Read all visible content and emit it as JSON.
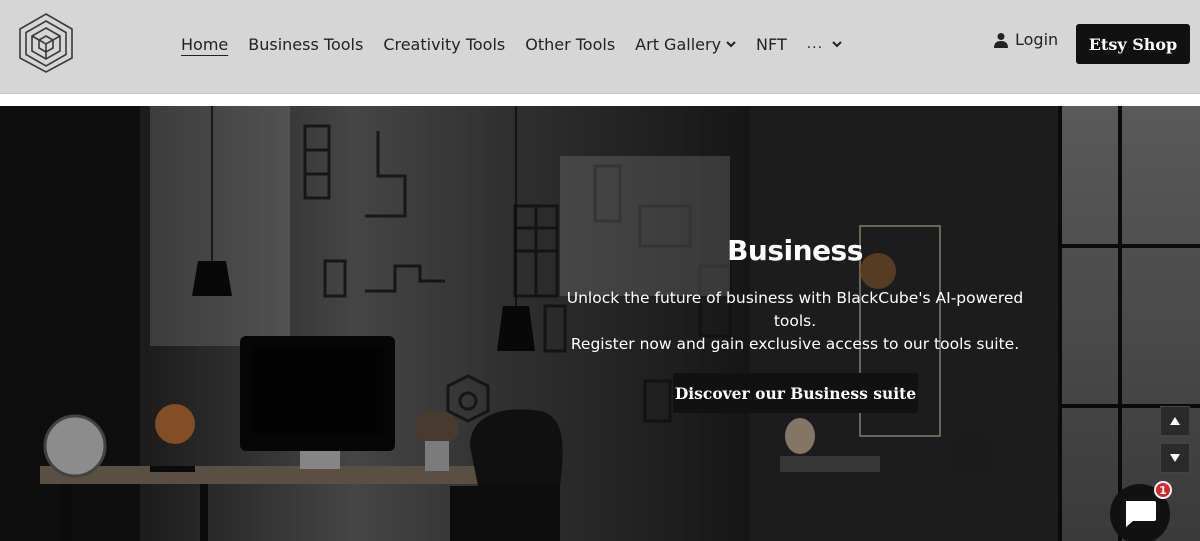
{
  "header": {
    "nav": [
      {
        "label": "Home"
      },
      {
        "label": "Business Tools"
      },
      {
        "label": "Creativity Tools"
      },
      {
        "label": "Other Tools"
      },
      {
        "label": "Art Gallery"
      },
      {
        "label": "NFT"
      },
      {
        "label": "..."
      }
    ],
    "login_label": "Login",
    "etsy_label": "Etsy Shop"
  },
  "hero": {
    "title": "Business",
    "subtitle_line1": "Unlock the future of business with BlackCube's AI-powered tools.",
    "subtitle_line2": "Register now and gain exclusive access to our tools suite.",
    "cta_label": "Discover our Business suite"
  },
  "chat": {
    "badge_count": "1"
  },
  "colors": {
    "header_bg": "#d6d6d6",
    "button_bg": "#111111",
    "badge": "#e02424"
  },
  "icons": [
    "cube-logo-icon",
    "chevron-down-icon",
    "user-icon",
    "arrow-up-icon",
    "arrow-down-icon",
    "chat-bubble-icon"
  ]
}
